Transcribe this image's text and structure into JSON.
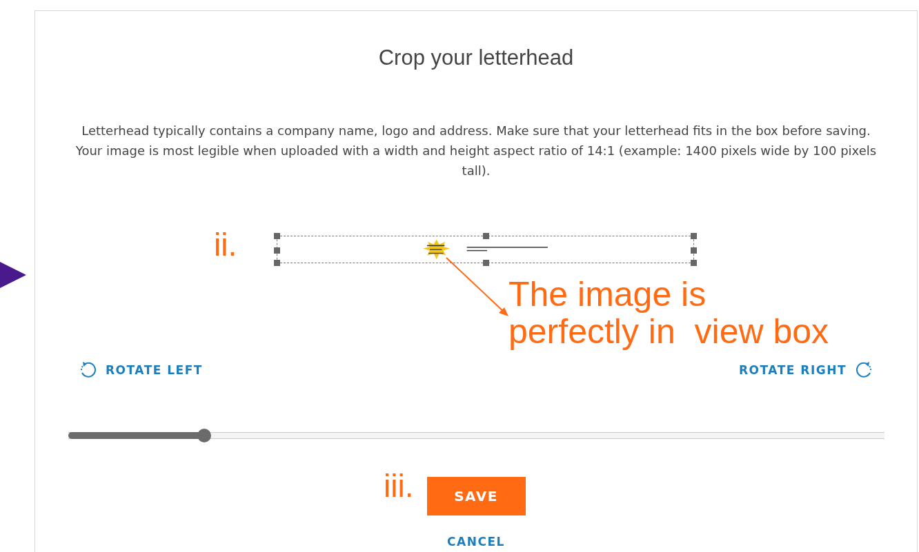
{
  "dialog": {
    "title": "Crop your letterhead",
    "description": "Letterhead typically contains a company name, logo and address. Make sure that your letterhead fits in the box before saving. Your image is most legible when uploaded with a width and height aspect ratio of 14:1 (example: 1400 pixels wide by 100 pixels tall).",
    "rotate_left": "ROTATE LEFT",
    "rotate_right": "ROTATE RIGHT",
    "zoom_slider": {
      "level": 0.167
    },
    "save_button": "SAVE",
    "cancel_link": "CANCEL"
  },
  "annotations": [
    {
      "kind": "marker",
      "text": "ii."
    },
    {
      "kind": "callout",
      "text": "The image is\nperfectly in  view box"
    },
    {
      "kind": "marker",
      "text": "iii."
    }
  ]
}
